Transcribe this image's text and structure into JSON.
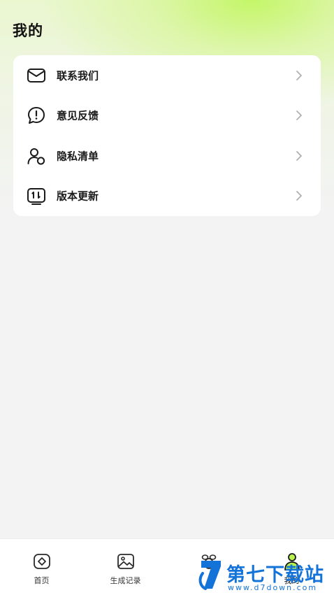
{
  "page": {
    "title": "我的"
  },
  "menu": {
    "items": [
      {
        "label": "联系我们",
        "icon": "mail-icon"
      },
      {
        "label": "意见反馈",
        "icon": "feedback-icon"
      },
      {
        "label": "隐私清单",
        "icon": "privacy-icon"
      },
      {
        "label": "版本更新",
        "icon": "update-icon"
      }
    ]
  },
  "nav": {
    "items": [
      {
        "label": "首页",
        "icon": "home-diamond-icon"
      },
      {
        "label": "生成记录",
        "icon": "image-icon"
      },
      {
        "label": "",
        "icon": "bee-icon"
      },
      {
        "label": "我的",
        "icon": "profile-icon",
        "active": true
      }
    ]
  },
  "watermark": {
    "text": "第七下载站",
    "url": "www.d7down.com"
  },
  "colors": {
    "accent": "#c4f668",
    "brand": "#1473d8"
  }
}
